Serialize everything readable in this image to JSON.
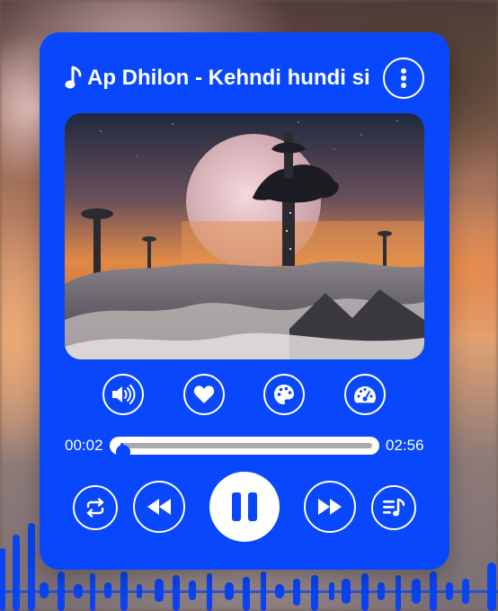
{
  "player": {
    "title": "Ap Dhilon - Kehndi hundi si",
    "current_time": "00:02",
    "duration": "02:56",
    "progress": 0.011,
    "icons": {
      "title": "music-note-icon",
      "menu": "more-vertical-icon",
      "volume": "volume-icon",
      "favorite": "heart-icon",
      "theme": "palette-icon",
      "speed": "speedometer-icon",
      "repeat": "repeat-icon",
      "previous": "rewind-icon",
      "play_pause": "pause-icon",
      "next": "fast-forward-icon",
      "playlist": "playlist-icon"
    }
  },
  "colors": {
    "accent": "#0847fb",
    "foreground": "#ffffff",
    "track": "#aaaaaa"
  }
}
